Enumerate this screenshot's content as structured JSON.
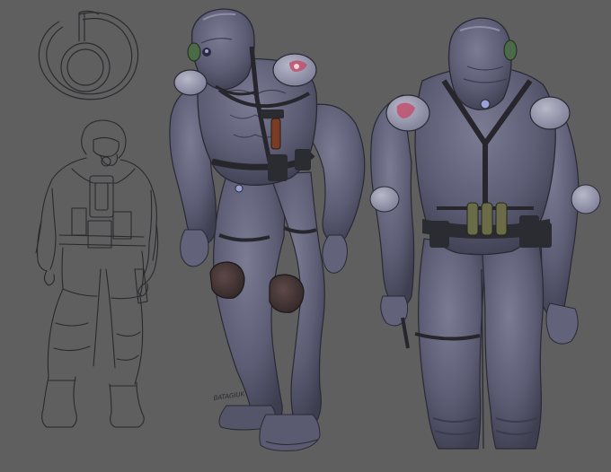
{
  "artwork": {
    "background_color": "#5f5f60",
    "suit_color": "#5c5d74",
    "suit_highlight": "#8e8fa6",
    "suit_shadow": "#3a3b4c",
    "strap_color": "#26262c",
    "kneepad_color": "#4a3a3a",
    "emblem_color": "#c0506e",
    "signature_text": "BATAGIUK",
    "icons": [
      "logo-emblem-icon",
      "sketch-soldier-figure",
      "front-armored-figure",
      "back-armored-figure"
    ]
  }
}
